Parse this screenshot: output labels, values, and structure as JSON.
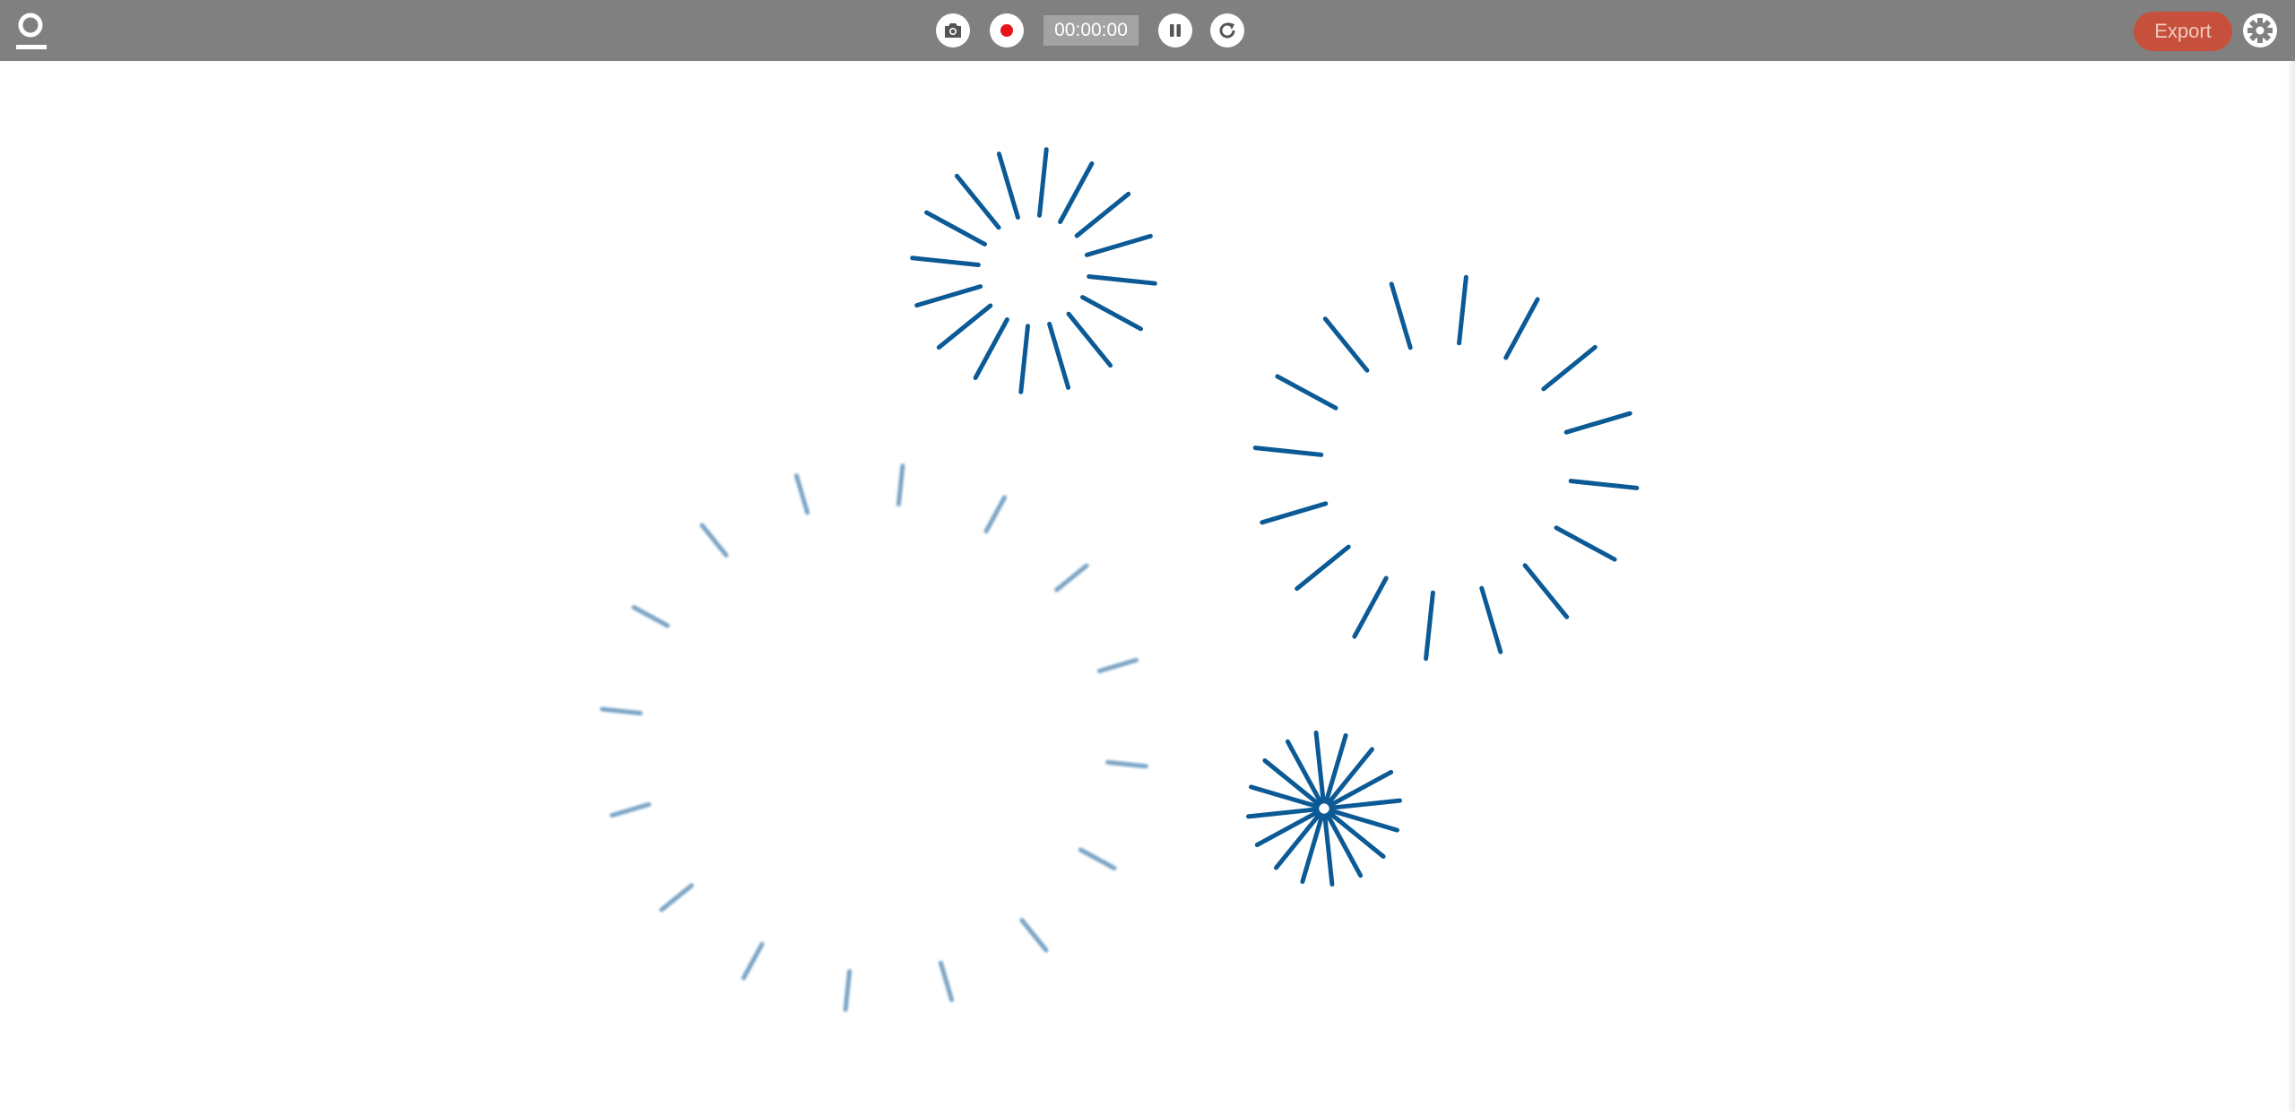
{
  "toolbar": {
    "logo": {
      "icon": "logo-icon"
    },
    "screenshot_button": {
      "icon": "camera-icon"
    },
    "record_button": {
      "icon": "record-icon",
      "color": "#e8141a"
    },
    "timer": {
      "value": "00:00:00"
    },
    "pause_button": {
      "icon": "pause-icon"
    },
    "restart_button": {
      "icon": "restart-icon"
    },
    "export_button": {
      "label": "Export",
      "color": "#c6503b"
    },
    "settings_button": {
      "icon": "gear-icon"
    },
    "background_color": "#808080"
  },
  "canvas": {
    "background": "#ffffff",
    "firework_color": "#0b5a96"
  }
}
